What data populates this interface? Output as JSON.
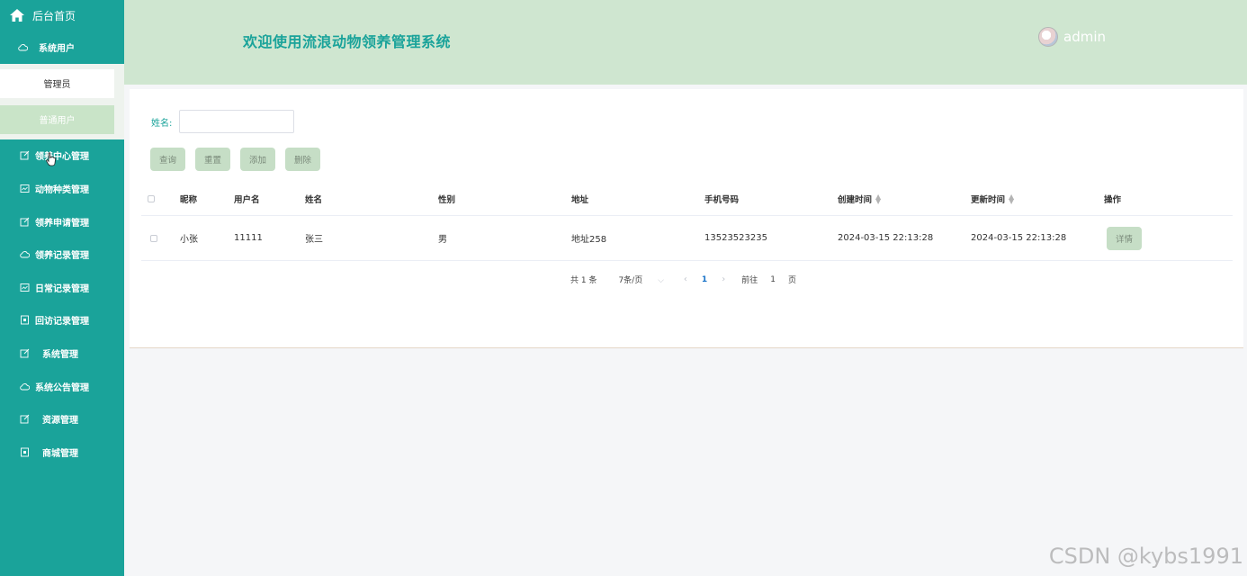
{
  "sidebar": {
    "brand": "后台首页",
    "group_system_users": "系统用户",
    "sub_items": [
      "管理员",
      "普通用户"
    ],
    "items": [
      "领养中心管理",
      "动物种类管理",
      "领养申请管理",
      "领养记录管理",
      "日常记录管理",
      "回访记录管理",
      "系统管理",
      "系统公告管理",
      "资源管理",
      "商城管理"
    ]
  },
  "header": {
    "title": "欢迎使用流浪动物领养管理系统",
    "user": "admin"
  },
  "search": {
    "label": "姓名:",
    "value": ""
  },
  "toolbar": {
    "query": "查询",
    "reset": "重置",
    "add": "添加",
    "delete": "删除"
  },
  "table": {
    "headers": [
      "昵称",
      "用户名",
      "姓名",
      "性别",
      "地址",
      "手机号码",
      "创建时间",
      "更新时间",
      "操作"
    ],
    "rows": [
      {
        "nickname": "小张",
        "username": "11111",
        "name": "张三",
        "gender": "男",
        "address": "地址258",
        "phone": "13523523235",
        "created": "2024-03-15 22:13:28",
        "updated": "2024-03-15 22:13:28",
        "action": "详情"
      }
    ]
  },
  "pagination": {
    "total": "共 1 条",
    "page_size": "7条/页",
    "current": "1",
    "goto_prefix": "前往",
    "goto_value": "1",
    "goto_suffix": "页"
  },
  "watermark": "CSDN @kybs1991",
  "colors": {
    "sidebar_bg": "#1aa39a",
    "header_bg": "#cfe6d0",
    "button_bg": "#c6dec6",
    "accent": "#1aa39a"
  }
}
